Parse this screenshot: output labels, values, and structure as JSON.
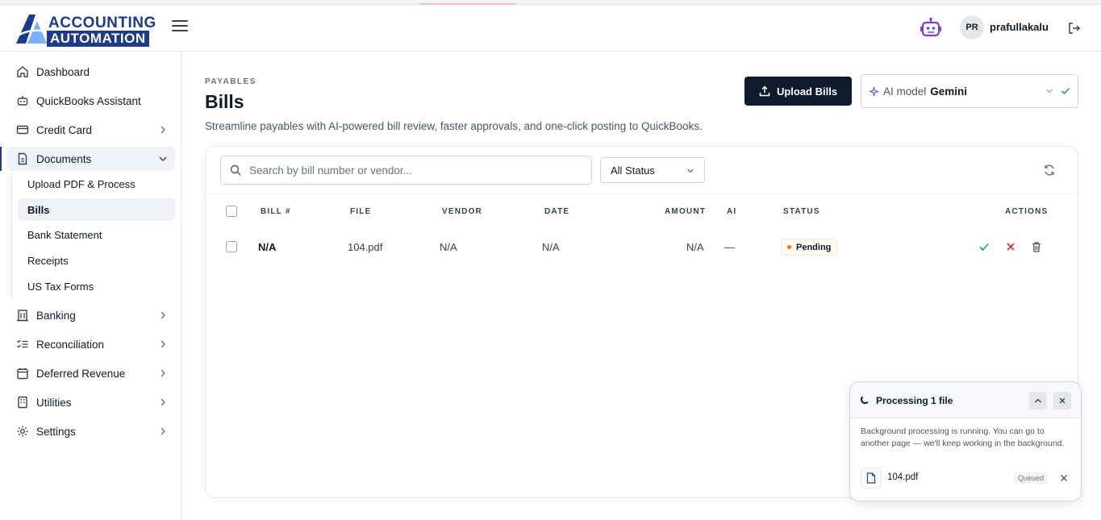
{
  "app": {
    "logo_line1": "ACCOUNTING",
    "logo_line2": "AUTOMATION"
  },
  "header": {
    "avatar_initials": "PR",
    "username": "prafullakalu"
  },
  "sidebar": {
    "items": [
      {
        "label": "Dashboard",
        "icon": "home-icon"
      },
      {
        "label": "QuickBooks Assistant",
        "icon": "bot-icon"
      },
      {
        "label": "Credit Card",
        "icon": "credit-card-icon"
      },
      {
        "label": "Documents",
        "icon": "document-icon"
      },
      {
        "label": "Banking",
        "icon": "bank-icon"
      },
      {
        "label": "Reconciliation",
        "icon": "checklist-icon"
      },
      {
        "label": "Deferred Revenue",
        "icon": "calendar-icon"
      },
      {
        "label": "Utilities",
        "icon": "building-icon"
      },
      {
        "label": "Settings",
        "icon": "gear-icon"
      }
    ],
    "documents_sub": [
      {
        "label": "Upload PDF & Process"
      },
      {
        "label": "Bills"
      },
      {
        "label": "Bank Statement"
      },
      {
        "label": "Receipts"
      },
      {
        "label": "US Tax Forms"
      }
    ]
  },
  "page": {
    "eyebrow": "PAYABLES",
    "title": "Bills",
    "subtitle": "Streamline payables with AI-powered bill review, faster approvals, and one-click posting to QuickBooks."
  },
  "toolbar": {
    "upload_label": "Upload Bills",
    "ai_model_label": "AI model",
    "ai_model_value": "Gemini"
  },
  "filters": {
    "search_placeholder": "Search by bill number or vendor...",
    "status_value": "All Status"
  },
  "table": {
    "columns": [
      "BILL #",
      "FILE",
      "VENDOR",
      "DATE",
      "AMOUNT",
      "AI",
      "STATUS",
      "ACTIONS"
    ],
    "rows": [
      {
        "bill": "N/A",
        "file": "104.pdf",
        "vendor": "N/A",
        "date": "N/A",
        "amount": "N/A",
        "ai": "—",
        "status": "Pending"
      }
    ]
  },
  "toast": {
    "title": "Processing 1 file",
    "message": "Background processing is running. You can go to another page — we'll keep working in the background.",
    "file_name": "104.pdf",
    "file_status": "Queued"
  },
  "colors": {
    "brand": "#1e3a8a",
    "primary_button": "#0f1b2d",
    "accept": "#16a34a",
    "reject": "#dc2626",
    "pending_dot": "#f97316",
    "bot_icon": "#7c3aed"
  }
}
